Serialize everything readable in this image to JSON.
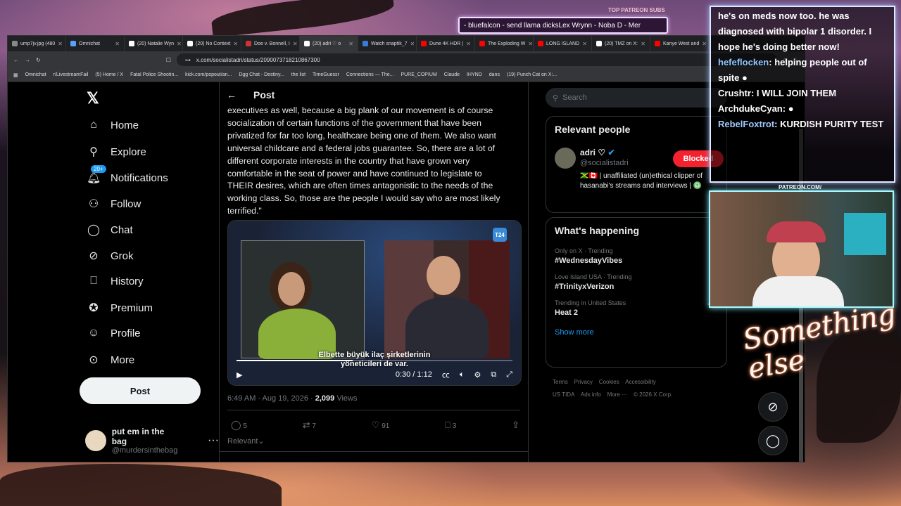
{
  "stream": {
    "patreon_label": "TOP PATREON SUBS",
    "ticker": "- bluefalcon - send llama dicksLex Wrynn -  Noba D - Mer",
    "patreon_handle": "PATREON.COM/",
    "script_text": "Something else"
  },
  "chat": [
    {
      "user": "",
      "text": "he's on meds now too. he was diagnosed with bipolar 1 disorder. I hope he's doing better now!"
    },
    {
      "user": "hefeflocken",
      "text": ": helping people out of spite"
    },
    {
      "user": "Crushtr",
      "text": ": I WILL JOIN THEM"
    },
    {
      "user": "ArchdukeCyan",
      "text": ":"
    },
    {
      "user": "RebelFoxtrot",
      "text": ": KURDISH PURITY TEST"
    }
  ],
  "browser": {
    "tabs": [
      {
        "label": "ump7jv.jpg (480",
        "color": "#888"
      },
      {
        "label": "Omnichat",
        "color": "#5aa0ff"
      },
      {
        "label": "(20) Natalie Wyn",
        "color": "#fff"
      },
      {
        "label": "(20) No Context",
        "color": "#fff"
      },
      {
        "label": "Doe v. Bonnell, I",
        "color": "#c33"
      },
      {
        "label": "(20) adri ♡ o",
        "color": "#fff"
      },
      {
        "label": "Watch snaptik_7",
        "color": "#3a7bd5"
      },
      {
        "label": "Dune 4K HDR |",
        "color": "#f00"
      },
      {
        "label": "The Exploding W",
        "color": "#f00"
      },
      {
        "label": "LONG ISLAND",
        "color": "#f00"
      },
      {
        "label": "(20) TMZ on X:",
        "color": "#fff"
      },
      {
        "label": "Kanye West and",
        "color": "#f00"
      }
    ],
    "url": "x.com/socialistadri/status/2090073718210867300",
    "bookmarks": [
      "Omnichat",
      "r/LivestreamFail",
      "(5) Home / X",
      "Fatal Police Shootin...",
      "kick.com/popout/an...",
      "Dgg Chat - Destiny...",
      "the list",
      "TimeGuessr",
      "Connections — The...",
      "PURE_COPIUM",
      "Claude",
      "IHYND",
      "dans",
      "(19) Punch Cat on X:..."
    ]
  },
  "nav": {
    "items": [
      "Home",
      "Explore",
      "Notifications",
      "Follow",
      "Chat",
      "Grok",
      "History",
      "Premium",
      "Profile",
      "More"
    ],
    "notif_badge": "20+",
    "post_button": "Post",
    "user_name": "put em in the bag",
    "user_handle": "@murdersinthebag"
  },
  "post": {
    "header": "Post",
    "text": "executives as well, because a big plank of our movement is of course socialization of certain functions of the government that have been privatized for far too long, healthcare being one of them. We also want universal childcare and a federal jobs guarantee. So, there are a lot of different corporate interests in the country that have grown very comfortable in the seat of power and have continued to legislate to THEIR desires, which are often times antagonistic to the needs of the working class. So, those are the people I would say who are most likely terrified.\"",
    "video_badge": "T24",
    "subtitle1": "Elbette büyük ilaç şirketlerinin",
    "subtitle2": "yöneticileri de var.",
    "video_time": "0:30 / 1:12",
    "video_progress": 0.42,
    "timestamp": "6:49 AM · Aug 19, 2026 · ",
    "views_count": "2,099",
    "views_label": " Views",
    "replies": "5",
    "reposts": "7",
    "likes": "91",
    "bookmarks": "3",
    "sort": "Relevant"
  },
  "sidebar": {
    "search_placeholder": "Search",
    "relevant_title": "Relevant people",
    "person_name": "adri ♡",
    "person_handle": "@socialistadri",
    "blocked_label": "Blocked",
    "person_bio": "🇯🇲🇨🇦 | unaffiliated (un)ethical clipper of hasanabi's streams and interviews | ♎",
    "happening_title": "What's happening",
    "trends": [
      {
        "context": "Only on X · Trending",
        "title": "#WednesdayVibes"
      },
      {
        "context": "Love Island USA · Trending",
        "title": "#TrinityxVerizon"
      },
      {
        "context": "Trending in United States",
        "title": "Heat 2"
      }
    ],
    "show_more": "Show more",
    "footer": [
      "Terms",
      "Privacy",
      "Cookies",
      "Accessibility",
      "US TIDA",
      "Ads info",
      "More ···",
      "© 2026 X Corp."
    ]
  }
}
